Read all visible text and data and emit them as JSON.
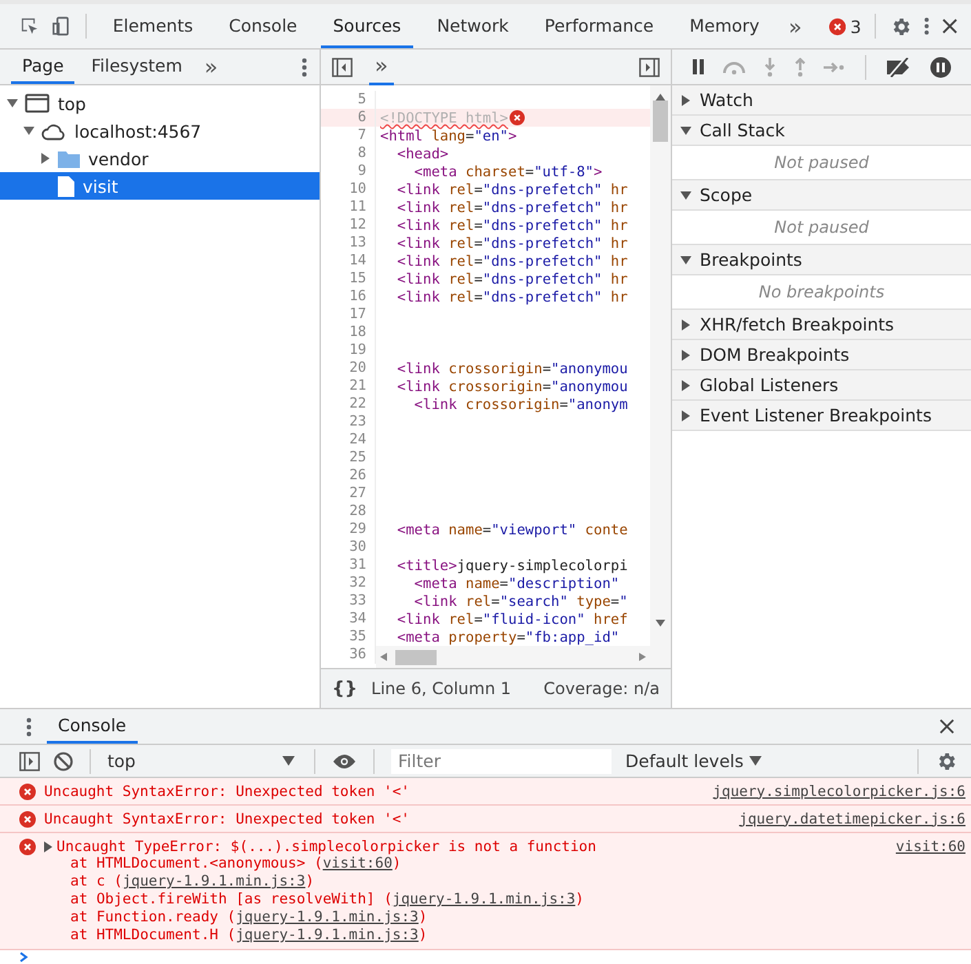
{
  "main_tabs": [
    {
      "label": "Elements",
      "selected": false
    },
    {
      "label": "Console",
      "selected": false
    },
    {
      "label": "Sources",
      "selected": true
    },
    {
      "label": "Network",
      "selected": false
    },
    {
      "label": "Performance",
      "selected": false
    },
    {
      "label": "Memory",
      "selected": false
    }
  ],
  "main_overflow": "»",
  "error_count": "3",
  "navigator": {
    "tabs": [
      {
        "label": "Page",
        "selected": true
      },
      {
        "label": "Filesystem",
        "selected": false
      }
    ],
    "overflow": "»",
    "tree": [
      {
        "label": "top",
        "kind": "frame",
        "expanded": true,
        "selected": false,
        "children": [
          {
            "label": "localhost:4567",
            "kind": "cloud",
            "expanded": true,
            "selected": false,
            "children": [
              {
                "label": "vendor",
                "kind": "folder",
                "expanded": false,
                "selected": false
              },
              {
                "label": "visit",
                "kind": "file",
                "selected": true
              }
            ]
          }
        ]
      }
    ]
  },
  "editor": {
    "overflow": "»",
    "lines": [
      {
        "number": "5"
      },
      {
        "number": "6",
        "error": true,
        "tokens": [
          {
            "kind": "doctype",
            "text": "<!DOCTYPE html>"
          }
        ]
      },
      {
        "number": "7",
        "tokens": [
          {
            "kind": "tag",
            "text": "<html"
          },
          {
            "kind": "attr",
            "text": " lang"
          },
          {
            "kind": "punct",
            "text": "="
          },
          {
            "kind": "value",
            "text": "\"en\""
          },
          {
            "kind": "tag",
            "text": ">"
          }
        ]
      },
      {
        "number": "8",
        "tokens": [
          {
            "kind": "tag",
            "text": "  <head>"
          }
        ]
      },
      {
        "number": "9",
        "tokens": [
          {
            "kind": "tag",
            "text": "    <meta"
          },
          {
            "kind": "attr",
            "text": " charset"
          },
          {
            "kind": "punct",
            "text": "="
          },
          {
            "kind": "value",
            "text": "\"utf-8\""
          },
          {
            "kind": "tag",
            "text": ">"
          }
        ]
      },
      {
        "number": "10",
        "tokens": [
          {
            "kind": "tag",
            "text": "  <link"
          },
          {
            "kind": "attr",
            "text": " rel"
          },
          {
            "kind": "punct",
            "text": "="
          },
          {
            "kind": "value",
            "text": "\"dns-prefetch\""
          },
          {
            "kind": "attr",
            "text": " hr"
          }
        ]
      },
      {
        "number": "11",
        "tokens": [
          {
            "kind": "tag",
            "text": "  <link"
          },
          {
            "kind": "attr",
            "text": " rel"
          },
          {
            "kind": "punct",
            "text": "="
          },
          {
            "kind": "value",
            "text": "\"dns-prefetch\""
          },
          {
            "kind": "attr",
            "text": " hr"
          }
        ]
      },
      {
        "number": "12",
        "tokens": [
          {
            "kind": "tag",
            "text": "  <link"
          },
          {
            "kind": "attr",
            "text": " rel"
          },
          {
            "kind": "punct",
            "text": "="
          },
          {
            "kind": "value",
            "text": "\"dns-prefetch\""
          },
          {
            "kind": "attr",
            "text": " hr"
          }
        ]
      },
      {
        "number": "13",
        "tokens": [
          {
            "kind": "tag",
            "text": "  <link"
          },
          {
            "kind": "attr",
            "text": " rel"
          },
          {
            "kind": "punct",
            "text": "="
          },
          {
            "kind": "value",
            "text": "\"dns-prefetch\""
          },
          {
            "kind": "attr",
            "text": " hr"
          }
        ]
      },
      {
        "number": "14",
        "tokens": [
          {
            "kind": "tag",
            "text": "  <link"
          },
          {
            "kind": "attr",
            "text": " rel"
          },
          {
            "kind": "punct",
            "text": "="
          },
          {
            "kind": "value",
            "text": "\"dns-prefetch\""
          },
          {
            "kind": "attr",
            "text": " hr"
          }
        ]
      },
      {
        "number": "15",
        "tokens": [
          {
            "kind": "tag",
            "text": "  <link"
          },
          {
            "kind": "attr",
            "text": " rel"
          },
          {
            "kind": "punct",
            "text": "="
          },
          {
            "kind": "value",
            "text": "\"dns-prefetch\""
          },
          {
            "kind": "attr",
            "text": " hr"
          }
        ]
      },
      {
        "number": "16",
        "tokens": [
          {
            "kind": "tag",
            "text": "  <link"
          },
          {
            "kind": "attr",
            "text": " rel"
          },
          {
            "kind": "punct",
            "text": "="
          },
          {
            "kind": "value",
            "text": "\"dns-prefetch\""
          },
          {
            "kind": "attr",
            "text": " hr"
          }
        ]
      },
      {
        "number": "17"
      },
      {
        "number": "18"
      },
      {
        "number": "19"
      },
      {
        "number": "20",
        "tokens": [
          {
            "kind": "tag",
            "text": "  <link"
          },
          {
            "kind": "attr",
            "text": " crossorigin"
          },
          {
            "kind": "punct",
            "text": "="
          },
          {
            "kind": "value",
            "text": "\"anonymou"
          }
        ]
      },
      {
        "number": "21",
        "tokens": [
          {
            "kind": "tag",
            "text": "  <link"
          },
          {
            "kind": "attr",
            "text": " crossorigin"
          },
          {
            "kind": "punct",
            "text": "="
          },
          {
            "kind": "value",
            "text": "\"anonymou"
          }
        ]
      },
      {
        "number": "22",
        "tokens": [
          {
            "kind": "tag",
            "text": "    <link"
          },
          {
            "kind": "attr",
            "text": " crossorigin"
          },
          {
            "kind": "punct",
            "text": "="
          },
          {
            "kind": "value",
            "text": "\"anonym"
          }
        ]
      },
      {
        "number": "23"
      },
      {
        "number": "24"
      },
      {
        "number": "25"
      },
      {
        "number": "26"
      },
      {
        "number": "27"
      },
      {
        "number": "28"
      },
      {
        "number": "29",
        "tokens": [
          {
            "kind": "tag",
            "text": "  <meta"
          },
          {
            "kind": "attr",
            "text": " name"
          },
          {
            "kind": "punct",
            "text": "="
          },
          {
            "kind": "value",
            "text": "\"viewport\""
          },
          {
            "kind": "attr",
            "text": " conte"
          }
        ]
      },
      {
        "number": "30"
      },
      {
        "number": "31",
        "tokens": [
          {
            "kind": "tag",
            "text": "  <title>"
          },
          {
            "kind": "text",
            "text": "jquery-simplecolorpi"
          }
        ]
      },
      {
        "number": "32",
        "tokens": [
          {
            "kind": "tag",
            "text": "    <meta"
          },
          {
            "kind": "attr",
            "text": " name"
          },
          {
            "kind": "punct",
            "text": "="
          },
          {
            "kind": "value",
            "text": "\"description\""
          }
        ]
      },
      {
        "number": "33",
        "tokens": [
          {
            "kind": "tag",
            "text": "    <link"
          },
          {
            "kind": "attr",
            "text": " rel"
          },
          {
            "kind": "punct",
            "text": "="
          },
          {
            "kind": "value",
            "text": "\"search\""
          },
          {
            "kind": "attr",
            "text": " type"
          },
          {
            "kind": "punct",
            "text": "="
          },
          {
            "kind": "value",
            "text": "\""
          }
        ]
      },
      {
        "number": "34",
        "tokens": [
          {
            "kind": "tag",
            "text": "  <link"
          },
          {
            "kind": "attr",
            "text": " rel"
          },
          {
            "kind": "punct",
            "text": "="
          },
          {
            "kind": "value",
            "text": "\"fluid-icon\""
          },
          {
            "kind": "attr",
            "text": " href"
          }
        ]
      },
      {
        "number": "35",
        "tokens": [
          {
            "kind": "tag",
            "text": "  <meta"
          },
          {
            "kind": "attr",
            "text": " property"
          },
          {
            "kind": "punct",
            "text": "="
          },
          {
            "kind": "value",
            "text": "\"fb:app_id\""
          }
        ]
      },
      {
        "number": "36"
      }
    ],
    "status": {
      "format": "{}",
      "position": "Line 6, Column 1",
      "coverage": "Coverage: n/a"
    }
  },
  "debugger": {
    "sections": [
      {
        "title": "Watch",
        "expanded": false
      },
      {
        "title": "Call Stack",
        "expanded": true,
        "message": "Not paused"
      },
      {
        "title": "Scope",
        "expanded": true,
        "message": "Not paused"
      },
      {
        "title": "Breakpoints",
        "expanded": true,
        "message": "No breakpoints"
      },
      {
        "title": "XHR/fetch Breakpoints",
        "expanded": false
      },
      {
        "title": "DOM Breakpoints",
        "expanded": false
      },
      {
        "title": "Global Listeners",
        "expanded": false
      },
      {
        "title": "Event Listener Breakpoints",
        "expanded": false
      }
    ]
  },
  "console": {
    "tab": {
      "label": "Console",
      "selected": true
    },
    "context": "top",
    "filter": {
      "placeholder": "Filter"
    },
    "levels": "Default levels",
    "messages": [
      {
        "kind": "error",
        "text": "Uncaught SyntaxError: Unexpected token '<'",
        "source": "jquery.simplecolorpicker.js:6"
      },
      {
        "kind": "error",
        "text": "Uncaught SyntaxError: Unexpected token '<'",
        "source": "jquery.datetimepicker.js:6"
      },
      {
        "kind": "error",
        "text": "Uncaught TypeError: $(...).simplecolorpicker is not a function",
        "source": "visit:60",
        "expanded": false,
        "stack": [
          {
            "prefix": "at HTMLDocument.<anonymous> (",
            "link": "visit:60",
            "suffix": ")"
          },
          {
            "prefix": "at c (",
            "link": "jquery-1.9.1.min.js:3",
            "suffix": ")"
          },
          {
            "prefix": "at Object.fireWith [as resolveWith] (",
            "link": "jquery-1.9.1.min.js:3",
            "suffix": ")"
          },
          {
            "prefix": "at Function.ready (",
            "link": "jquery-1.9.1.min.js:3",
            "suffix": ")"
          },
          {
            "prefix": "at HTMLDocument.H (",
            "link": "jquery-1.9.1.min.js:3",
            "suffix": ")"
          }
        ]
      }
    ]
  }
}
